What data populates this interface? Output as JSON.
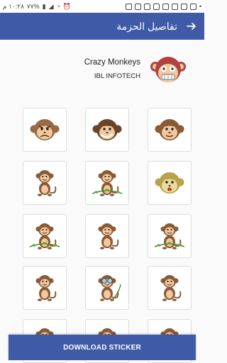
{
  "status_bar": {
    "time": "١٠:٢٨ م",
    "battery": "٧٧%"
  },
  "app_bar": {
    "title": "تفاصيل الحزمة",
    "back_icon": "arrow-right-icon"
  },
  "pack": {
    "name": "Crazy Monkeys",
    "author": "IBL INFOTECH"
  },
  "stickers": [
    {
      "name": "sticker-angry-bear-monkey",
      "kind": "face-angry"
    },
    {
      "name": "sticker-smirk-monkey",
      "kind": "face-smirk"
    },
    {
      "name": "sticker-smile-monkey",
      "kind": "face-smile"
    },
    {
      "name": "sticker-sitting-monkey",
      "kind": "body-sit"
    },
    {
      "name": "sticker-vine-monkey",
      "kind": "body-vine"
    },
    {
      "name": "sticker-green-monkey",
      "kind": "face-green"
    },
    {
      "name": "sticker-hanging-monkey",
      "kind": "body-vine"
    },
    {
      "name": "sticker-shy-monkey",
      "kind": "body-sit"
    },
    {
      "name": "sticker-branch-monkey",
      "kind": "body-vine"
    },
    {
      "name": "sticker-standing-monkey",
      "kind": "body-sit"
    },
    {
      "name": "sticker-glasses-monkey",
      "kind": "body-glasses"
    },
    {
      "name": "sticker-waving-monkey",
      "kind": "body-sit"
    },
    {
      "name": "sticker-partial-1",
      "kind": "body-sit"
    },
    {
      "name": "sticker-partial-2",
      "kind": "body-sit"
    },
    {
      "name": "sticker-partial-3",
      "kind": "body-sit"
    }
  ],
  "footer": {
    "download_label": "DOWNLOAD STICKER"
  },
  "colors": {
    "accent": "#3f5aa6",
    "monkey_brown": "#8a5a35",
    "monkey_face": "#f1c9a0"
  }
}
